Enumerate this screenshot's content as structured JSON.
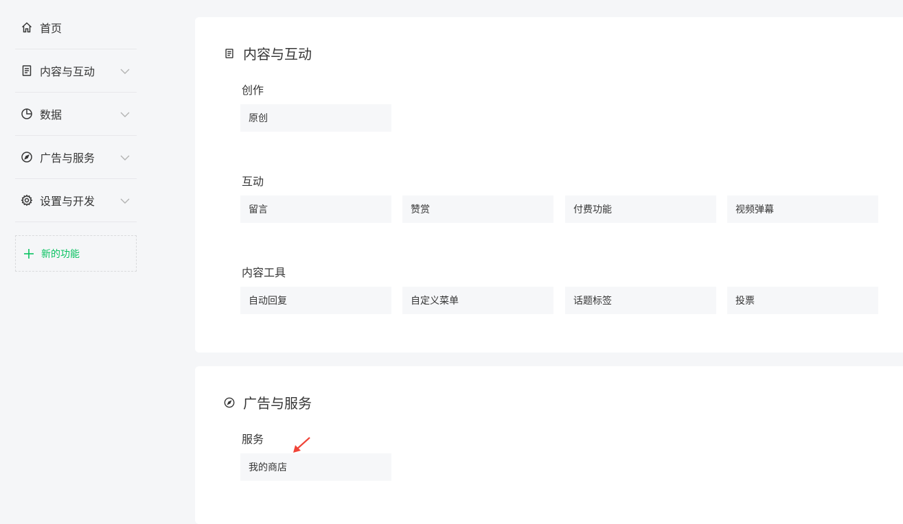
{
  "sidebar": {
    "items": [
      {
        "label": "首页",
        "icon": "home-icon",
        "expandable": false
      },
      {
        "label": "内容与互动",
        "icon": "document-icon",
        "expandable": true
      },
      {
        "label": "数据",
        "icon": "pie-chart-icon",
        "expandable": true
      },
      {
        "label": "广告与服务",
        "icon": "compass-icon",
        "expandable": true
      },
      {
        "label": "设置与开发",
        "icon": "gear-icon",
        "expandable": true
      }
    ],
    "new_feature_label": "新的功能"
  },
  "content_card": {
    "title": "内容与互动",
    "sections": [
      {
        "label": "创作",
        "items": [
          "原创"
        ]
      },
      {
        "label": "互动",
        "items": [
          "留言",
          "赞赏",
          "付费功能",
          "视频弹幕"
        ]
      },
      {
        "label": "内容工具",
        "items": [
          "自动回复",
          "自定义菜单",
          "话题标签",
          "投票"
        ]
      }
    ]
  },
  "ads_card": {
    "title": "广告与服务",
    "sections": [
      {
        "label": "服务",
        "items": [
          "我的商店"
        ]
      }
    ]
  },
  "colors": {
    "accent_green": "#07c160",
    "annotation_arrow": "#f04438",
    "tile_bg": "#f6f7f9",
    "page_bg": "#f5f6f8"
  }
}
